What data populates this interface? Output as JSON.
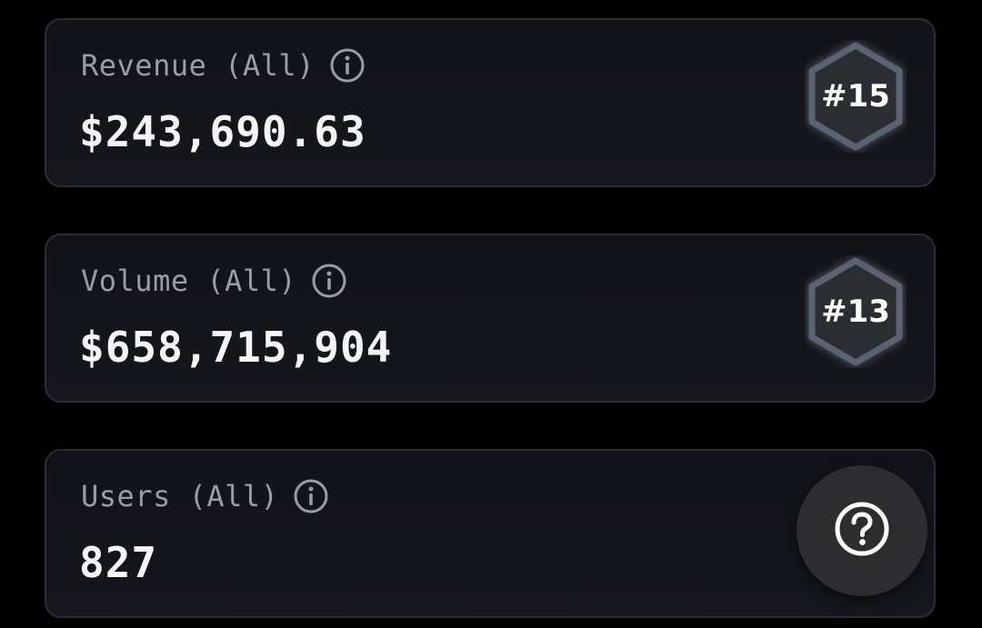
{
  "stats": [
    {
      "label": "Revenue (All)",
      "value": "$243,690.63",
      "rank": "#15"
    },
    {
      "label": "Volume (All)",
      "value": "$658,715,904",
      "rank": "#13"
    },
    {
      "label": "Users (All)",
      "value": "827"
    }
  ],
  "icons": {
    "info": "info-icon",
    "rank_badge": "hexagon-badge",
    "help": "question-mark-circle-icon"
  },
  "colors": {
    "background": "#000000",
    "card_background": "#14151a",
    "card_border": "#2b2e36",
    "label": "#9b9da3",
    "value": "#f5f5f7",
    "badge_fill": "#2a2d33",
    "badge_border": "#5c6470",
    "help_button": "#2d2d2f"
  }
}
